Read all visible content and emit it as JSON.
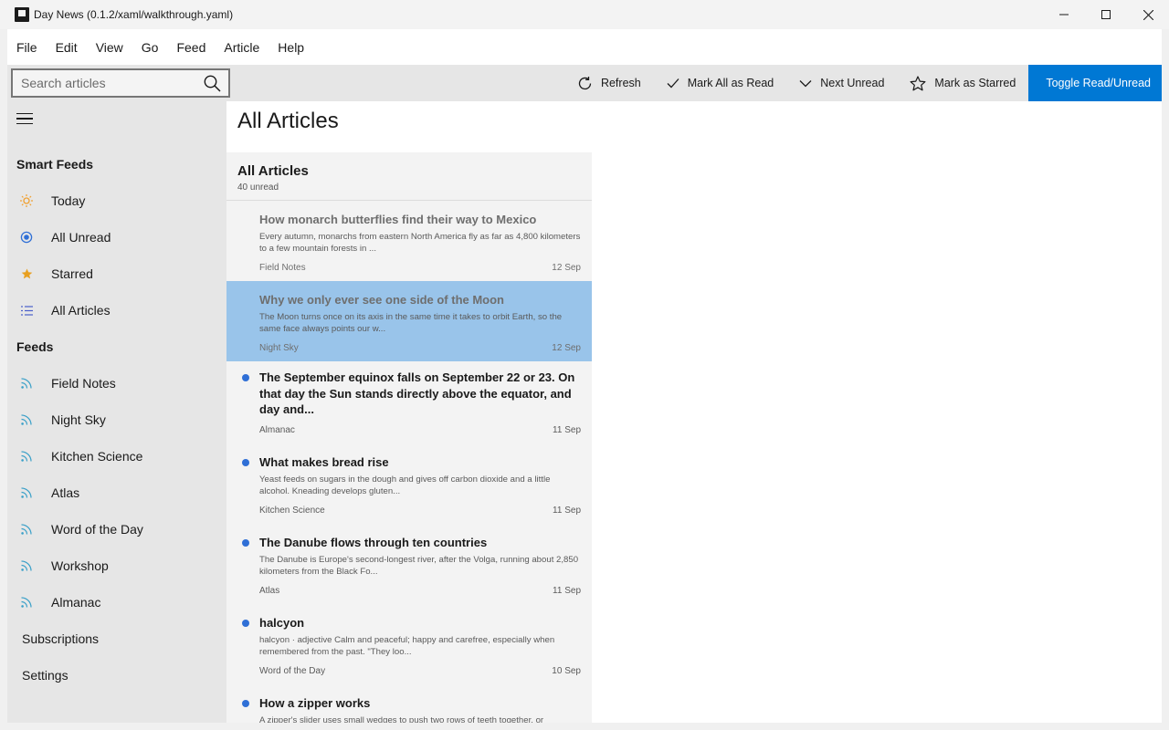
{
  "window": {
    "title": "Day News (0.1.2/xaml/walkthrough.yaml)",
    "controls": {
      "minimize_icon": "minimize-icon",
      "maximize_icon": "maximize-icon",
      "close_icon": "close-icon"
    }
  },
  "menu": [
    "File",
    "Edit",
    "View",
    "Go",
    "Feed",
    "Article",
    "Help"
  ],
  "toolbar": {
    "search_placeholder": "Search articles",
    "search_value": "",
    "refresh": "Refresh",
    "mark_all_read": "Mark All as Read",
    "next_unread": "Next Unread",
    "mark_starred": "Mark as Starred",
    "toggle_read": "Toggle Read/Unread",
    "accent_color": "#0078d4"
  },
  "sidebar": {
    "smart_feeds_heading": "Smart Feeds",
    "smart_feeds": [
      {
        "label": "Today",
        "icon": "sun-icon"
      },
      {
        "label": "All Unread",
        "icon": "radio-dot-icon"
      },
      {
        "label": "Starred",
        "icon": "star-icon"
      },
      {
        "label": "All Articles",
        "icon": "list-icon"
      }
    ],
    "feeds_heading": "Feeds",
    "feeds": [
      {
        "label": "Field Notes",
        "icon": "rss-icon"
      },
      {
        "label": "Night Sky",
        "icon": "rss-icon"
      },
      {
        "label": "Kitchen Science",
        "icon": "rss-icon"
      },
      {
        "label": "Atlas",
        "icon": "rss-icon"
      },
      {
        "label": "Word of the Day",
        "icon": "rss-icon"
      },
      {
        "label": "Workshop",
        "icon": "rss-icon"
      },
      {
        "label": "Almanac",
        "icon": "rss-icon"
      }
    ],
    "subscriptions": "Subscriptions",
    "settings": "Settings"
  },
  "main": {
    "page_title": "All Articles",
    "list_title": "All Articles",
    "list_count": "40 unread",
    "articles": [
      {
        "title": "How monarch butterflies find their way to Mexico",
        "snippet": "Every autumn, monarchs from eastern North America fly as far as 4,800 kilometers to a few mountain forests in ...",
        "feed": "Field Notes",
        "date": "12 Sep",
        "unread": false
      },
      {
        "title": "Why we only ever see one side of the Moon",
        "snippet": "The Moon turns once on its axis in the same time it takes to orbit Earth, so the same face always points our w...",
        "feed": "Night Sky",
        "date": "12 Sep",
        "unread": false
      },
      {
        "title": "The September equinox falls on September 22 or 23. On that day the Sun stands directly above the equator, and day and...",
        "snippet": "",
        "feed": "Almanac",
        "date": "11 Sep",
        "unread": true
      },
      {
        "title": "What makes bread rise",
        "snippet": "Yeast feeds on sugars in the dough and gives off carbon dioxide and a little alcohol. Kneading develops gluten...",
        "feed": "Kitchen Science",
        "date": "11 Sep",
        "unread": true
      },
      {
        "title": "The Danube flows through ten countries",
        "snippet": "The Danube is Europe's second-longest river, after the Volga, running about 2,850 kilometers from the Black Fo...",
        "feed": "Atlas",
        "date": "11 Sep",
        "unread": true
      },
      {
        "title": "halcyon",
        "snippet": "halcyon · adjective Calm and peaceful; happy and carefree, especially when remembered from the past. \"They loo...",
        "feed": "Word of the Day",
        "date": "10 Sep",
        "unread": true
      },
      {
        "title": "How a zipper works",
        "snippet": "A zipper's slider uses small wedges to push two rows of teeth together, or",
        "feed": "",
        "date": "",
        "unread": true
      }
    ]
  }
}
